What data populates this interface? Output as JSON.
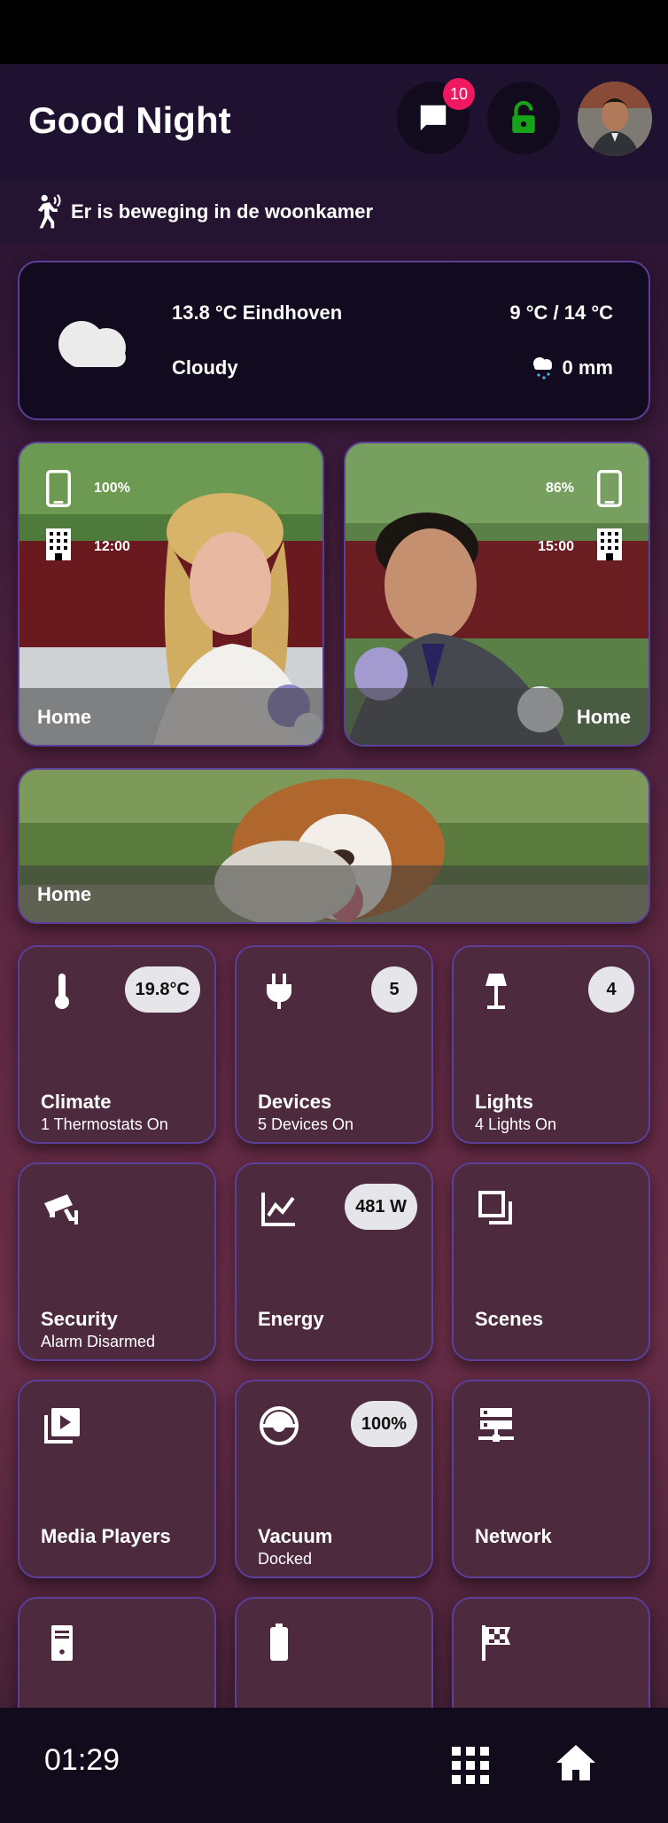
{
  "header": {
    "title": "Good Night",
    "notifications_count": "10"
  },
  "motion": {
    "text": "Er is beweging in de woonkamer"
  },
  "weather": {
    "temp_location": "13.8 °C Eindhoven",
    "condition": "Cloudy",
    "range": "9 °C / 14 °C",
    "precip": "0 mm"
  },
  "persons": [
    {
      "battery": "100%",
      "time": "12:00",
      "location": "Home"
    },
    {
      "battery": "86%",
      "time": "15:00",
      "location": "Home"
    }
  ],
  "pet": {
    "location": "Home"
  },
  "tiles": [
    {
      "name": "Climate",
      "sub": "1 Thermostats On",
      "badge": "19.8°C",
      "icon": "thermometer-icon"
    },
    {
      "name": "Devices",
      "sub": "5 Devices On",
      "badge": "5",
      "icon": "plug-icon"
    },
    {
      "name": "Lights",
      "sub": "4 Lights On",
      "badge": "4",
      "icon": "lamp-icon"
    },
    {
      "name": "Security",
      "sub": "Alarm Disarmed",
      "badge": "",
      "icon": "cctv-icon"
    },
    {
      "name": "Energy",
      "sub": "",
      "badge": "481 W",
      "icon": "chart-line-icon"
    },
    {
      "name": "Scenes",
      "sub": "",
      "badge": "",
      "icon": "scenes-icon"
    },
    {
      "name": "Media Players",
      "sub": "",
      "badge": "",
      "icon": "play-box-icon"
    },
    {
      "name": "Vacuum",
      "sub": "Docked",
      "badge": "100%",
      "icon": "robot-vacuum-icon"
    },
    {
      "name": "Network",
      "sub": "",
      "badge": "",
      "icon": "server-network-icon"
    },
    {
      "name": "",
      "sub": "",
      "badge": "",
      "icon": "computer-tower-icon"
    },
    {
      "name": "",
      "sub": "",
      "badge": "",
      "icon": "battery-icon"
    },
    {
      "name": "",
      "sub": "",
      "badge": "",
      "icon": "checkered-flag-icon"
    }
  ],
  "footer": {
    "time": "01:29"
  },
  "colors": {
    "accent_border": "#5b3f9a",
    "badge_red": "#f01860",
    "lock_green": "#17a317"
  }
}
